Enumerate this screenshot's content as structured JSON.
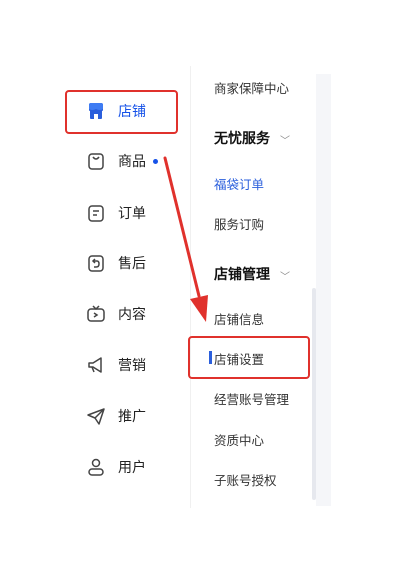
{
  "left_nav": {
    "items": [
      {
        "label": "店铺",
        "icon": "shop-icon",
        "active": true
      },
      {
        "label": "商品",
        "icon": "bag-icon",
        "badge_dot": true
      },
      {
        "label": "订单",
        "icon": "order-icon"
      },
      {
        "label": "售后",
        "icon": "after-sale-icon"
      },
      {
        "label": "内容",
        "icon": "tv-icon"
      },
      {
        "label": "营销",
        "icon": "megaphone-icon"
      },
      {
        "label": "推广",
        "icon": "paper-plane-icon"
      },
      {
        "label": "用户",
        "icon": "user-icon"
      }
    ]
  },
  "right_panel": {
    "top_item": "商家保障中心",
    "group1": {
      "title": "无忧服务",
      "items": [
        "福袋订单",
        "服务订购"
      ]
    },
    "group2": {
      "title": "店铺管理",
      "items": [
        "店铺信息",
        "店铺设置",
        "经营账号管理",
        "资质中心",
        "子账号授权"
      ]
    }
  },
  "colors": {
    "accent": "#1652e8",
    "highlight": "#e0312c",
    "text": "#222222"
  }
}
